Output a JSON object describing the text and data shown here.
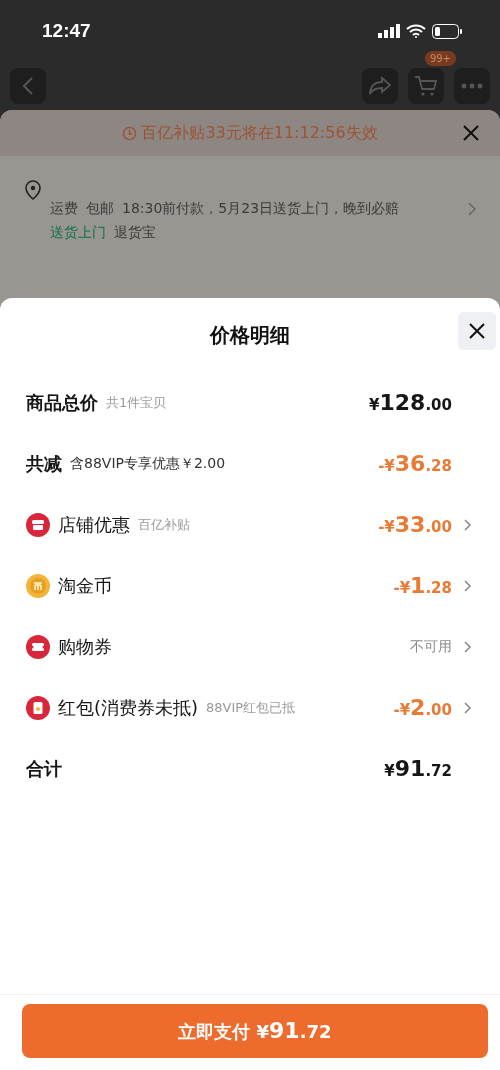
{
  "status_bar": {
    "time": "12:47"
  },
  "background": {
    "cart_badge": "99+",
    "banner": "百亿补贴33元将在11:12:56失效",
    "shipping": {
      "fee_label": "运费",
      "fee_value": "包邮",
      "delivery": "18:30前付款，5月23日送货上门，晚到必赔",
      "tags": [
        {
          "label": "送货上门",
          "color": "#0e7248"
        },
        {
          "label": "退货宝",
          "color": "#3a3a3a"
        }
      ]
    }
  },
  "sheet": {
    "title": "价格明细",
    "rows": [
      {
        "kind": "plain",
        "label": "商品总价",
        "note": "共1件宝贝",
        "note_strong": false,
        "amount": "¥128.00",
        "color": "#161616",
        "arrow": false
      },
      {
        "kind": "plain",
        "label": "共减",
        "note": "含88VIP专享优惠￥2.00",
        "note_strong": true,
        "amount": "-¥36.28",
        "color": "#e97a35",
        "arrow": false
      },
      {
        "kind": "shop",
        "label": "店铺优惠",
        "note": "百亿补贴",
        "note_strong": false,
        "amount": "-¥33.00",
        "color": "#e97a35",
        "arrow": true
      },
      {
        "kind": "coin",
        "label": "淘金币",
        "amount": "-¥1.28",
        "color": "#e97a35",
        "arrow": true
      },
      {
        "kind": "coupon",
        "label": "购物券",
        "amount": "不可用",
        "color": "#888888",
        "arrow": true
      },
      {
        "kind": "redpacket",
        "label": "红包(消费券未抵)",
        "note": "88VIP红包已抵",
        "note_strong": false,
        "amount": "-¥2.00",
        "color": "#e97a35",
        "arrow": true
      },
      {
        "kind": "plain",
        "label": "合计",
        "amount": "¥91.72",
        "color": "#161616",
        "arrow": false
      }
    ],
    "pay_button": {
      "label": "立即支付",
      "amount": "¥91.72"
    }
  }
}
